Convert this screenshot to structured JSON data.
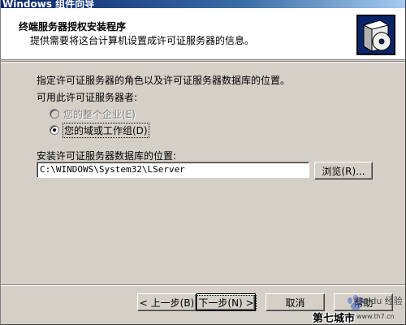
{
  "window": {
    "title": "Windows 组件向导"
  },
  "header": {
    "title": "终端服务器授权安装程序",
    "subtitle": "提供需要将这台计算机设置成许可证服务器的信息。",
    "icon": "setup-box-cd-icon"
  },
  "body": {
    "instruction": "指定许可证服务器的角色以及许可证服务器数据库的位置。",
    "role_label": "可用此许可证服务器者:",
    "roles": [
      {
        "label": "您的整个企业(E)",
        "selected": false,
        "enabled": false
      },
      {
        "label": "您的域或工作组(D)",
        "selected": true,
        "enabled": true
      }
    ],
    "db_location_label": "安装许可证服务器数据库的位置:",
    "db_path": "C:\\WINDOWS\\System32\\LServer",
    "browse_label": "浏览(R)..."
  },
  "footer": {
    "back_label": "< 上一步(B)",
    "next_label": "下一步(N) >",
    "cancel_label": "取消",
    "help_label": "帮助"
  },
  "watermark": {
    "text_top": "Baidu 经验",
    "text_main": "第七城市",
    "text_url": "www.th7.cn"
  }
}
